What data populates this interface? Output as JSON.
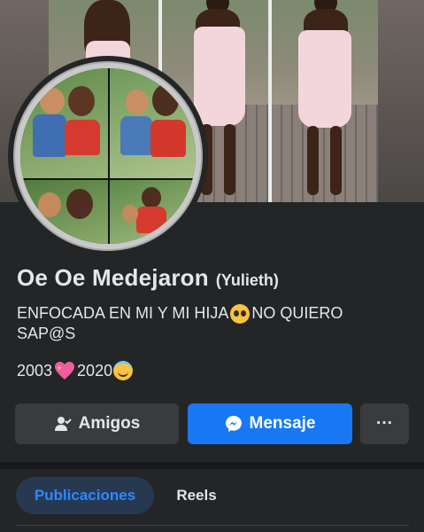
{
  "profile": {
    "name": "Oe Oe Medejaron",
    "alternate_name": "(Yulieth)",
    "bio_line_1": "ENFOCADA EN MI Y MI HIJA",
    "bio_line_1_tail": "NO QUIERO",
    "bio_line_2": "SAP@S",
    "year_start": "2003",
    "year_end": "2020"
  },
  "actions": {
    "friends_label": "Amigos",
    "message_label": "Mensaje",
    "more_label": "···"
  },
  "tabs": [
    {
      "label": "Publicaciones",
      "active": true
    },
    {
      "label": "Reels",
      "active": false
    }
  ],
  "icons": {
    "friends": "person-check-icon",
    "message": "messenger-icon",
    "more": "more-dots-icon",
    "bio_emoji": "pleading-face-emoji",
    "year_emoji_1": "sparkling-heart-emoji",
    "year_emoji_2": "smiling-face-with-halo-emoji"
  },
  "colors": {
    "background": "#242526",
    "accent": "#1877f2",
    "active_tab_bg": "#263951",
    "active_tab_text": "#2d88ff",
    "button_gray": "#3a3b3c"
  }
}
